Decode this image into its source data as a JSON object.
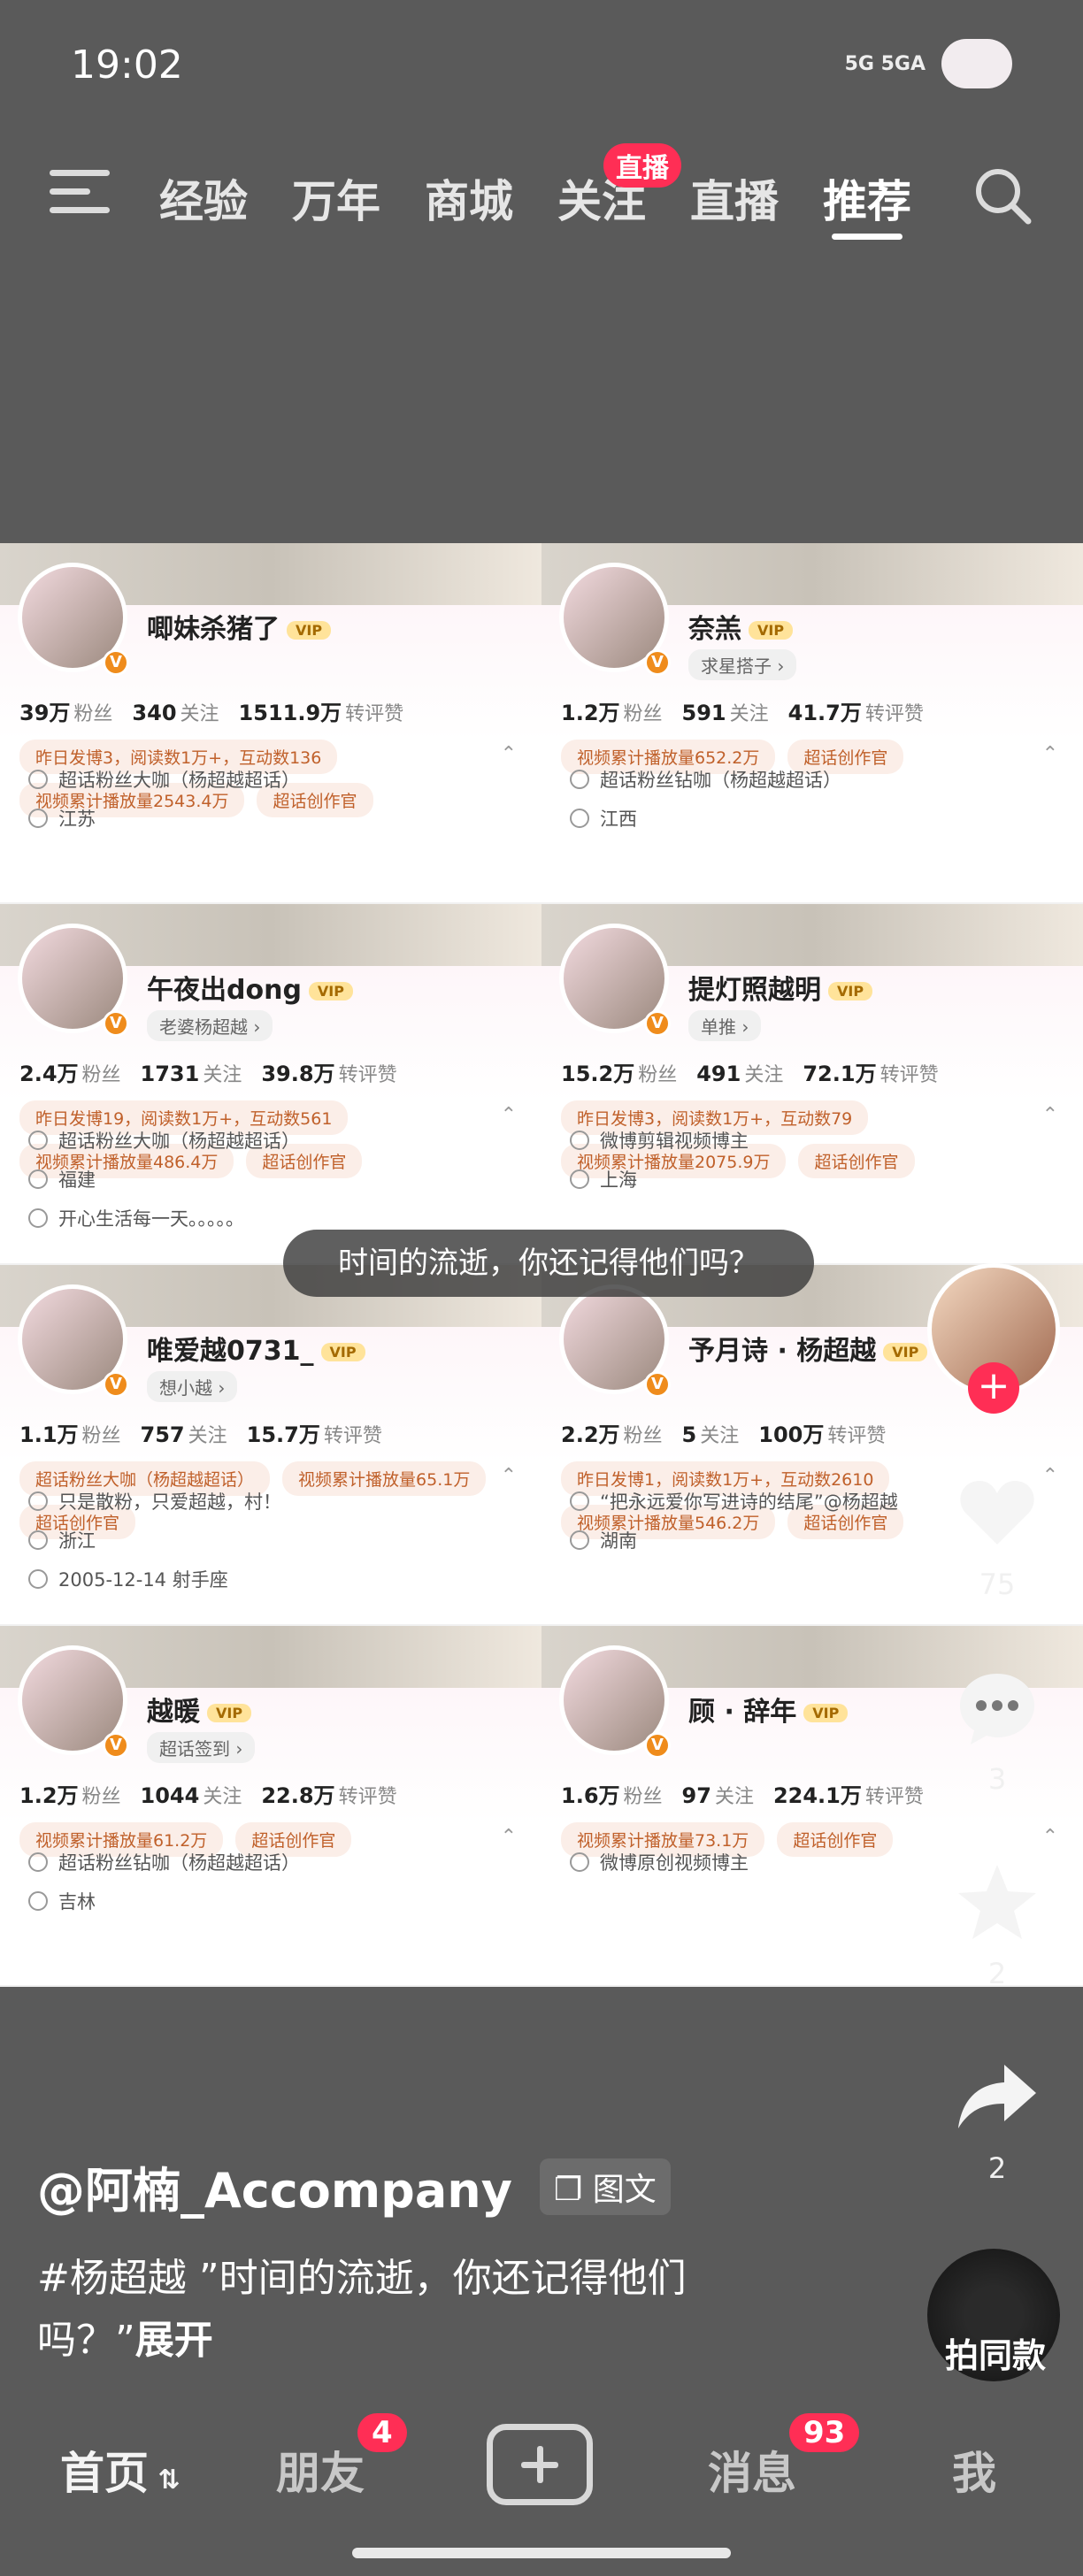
{
  "status": {
    "time": "19:02",
    "signal": "5G 5GA"
  },
  "topnav": {
    "tabs": [
      "经验",
      "万年",
      "商城",
      "关注",
      "直播",
      "推荐"
    ],
    "active": "推荐",
    "live_badge": "直播"
  },
  "cards": [
    {
      "name": "唧妹杀猪了",
      "sub": "",
      "fans": "39万",
      "follow": "340",
      "likes": "1511.9万",
      "tags": [
        "昨日发博3，阅读数1万+，互动数136",
        "视频累计播放量2543.4万",
        "超话创作官"
      ],
      "lines": [
        "超话粉丝大咖（杨超越超话）",
        "江苏"
      ]
    },
    {
      "name": "奈羔",
      "sub": "求星搭子 ›",
      "fans": "1.2万",
      "follow": "591",
      "likes": "41.7万",
      "tags": [
        "视频累计播放量652.2万",
        "超话创作官"
      ],
      "lines": [
        "超话粉丝钻咖（杨超越超话）",
        "江西"
      ]
    },
    {
      "name": "午夜出dong",
      "sub": "老婆杨超越 ›",
      "fans": "2.4万",
      "follow": "1731",
      "likes": "39.8万",
      "tags": [
        "昨日发博19，阅读数1万+，互动数561",
        "视频累计播放量486.4万",
        "超话创作官"
      ],
      "lines": [
        "超话粉丝大咖（杨超越超话）",
        "福建",
        "开心生活每一天。。。。。"
      ]
    },
    {
      "name": "提灯照越明",
      "sub": "单推 ›",
      "fans": "15.2万",
      "follow": "491",
      "likes": "72.1万",
      "tags": [
        "昨日发博3，阅读数1万+，互动数79",
        "视频累计播放量2075.9万",
        "超话创作官"
      ],
      "lines": [
        "微博剪辑视频博主",
        "上海"
      ]
    },
    {
      "name": "唯爱越0731_",
      "sub": "想小越 ›",
      "fans": "1.1万",
      "follow": "757",
      "likes": "15.7万",
      "tags": [
        "超话粉丝大咖（杨超越超话）",
        "视频累计播放量65.1万",
        "超话创作官"
      ],
      "lines": [
        "只是散粉，只爱超越，村！",
        "浙江",
        "2005-12-14 射手座"
      ]
    },
    {
      "name": "予月诗 · 杨超越",
      "sub": "",
      "fans": "2.2万",
      "follow": "5",
      "likes": "100万",
      "tags": [
        "昨日发博1，阅读数1万+，互动数2610",
        "视频累计播放量546.2万",
        "超话创作官"
      ],
      "lines": [
        "“把永远爱你写进诗的结尾”@杨超越",
        "湖南"
      ]
    },
    {
      "name": "越暖",
      "sub": "超话签到 ›",
      "fans": "1.2万",
      "follow": "1044",
      "likes": "22.8万",
      "tags": [
        "视频累计播放量61.2万",
        "超话创作官"
      ],
      "lines": [
        "超话粉丝钻咖（杨超越超话）",
        "吉林"
      ]
    },
    {
      "name": "顾 · 辞年",
      "sub": "",
      "fans": "1.6万",
      "follow": "97",
      "likes": "224.1万",
      "tags": [
        "视频累计播放量73.1万",
        "超话创作官"
      ],
      "lines": [
        "微博原创视频博主"
      ]
    }
  ],
  "labels": {
    "fans": "粉丝",
    "follow": "关注",
    "likes": "转评赞"
  },
  "subtitle": "时间的流逝，你还记得他们吗？",
  "side": {
    "likes": "75",
    "comments": "3",
    "favorites": "2",
    "shares": "2"
  },
  "caption": {
    "author": "@阿楠_Accompany",
    "type": "图文",
    "desc": "#杨超越 ”时间的流逝，你还记得他们吗？”",
    "expand": "展开",
    "same": "拍同款"
  },
  "bottom_nav": {
    "home": "首页",
    "friends": "朋友",
    "friends_badge": "4",
    "messages": "消息",
    "messages_badge": "93",
    "me": "我"
  }
}
